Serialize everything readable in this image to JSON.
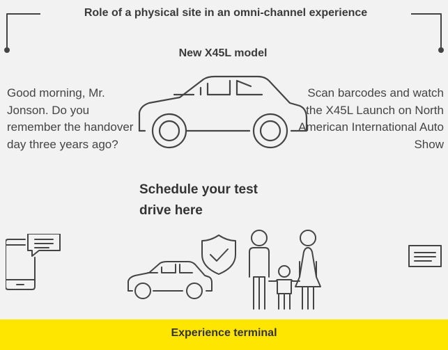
{
  "title": "Role of a physical site in an omni-channel experience",
  "model_label": "New X45L model",
  "left_text": "Good morning, Mr. Jonson. Do you remember the handover day three years ago?",
  "right_text": "Scan barcodes and watch the X45L Launch on North American International Auto Show",
  "schedule_text": "Schedule your test drive here",
  "footer_label": "Experience terminal",
  "colors": {
    "accent": "#ffe600",
    "background": "#f2f2f2",
    "ink": "#444444"
  },
  "icons": [
    "car-icon",
    "phone-message-icon",
    "document-icon",
    "car-small-icon",
    "shield-check-icon",
    "family-icon"
  ]
}
